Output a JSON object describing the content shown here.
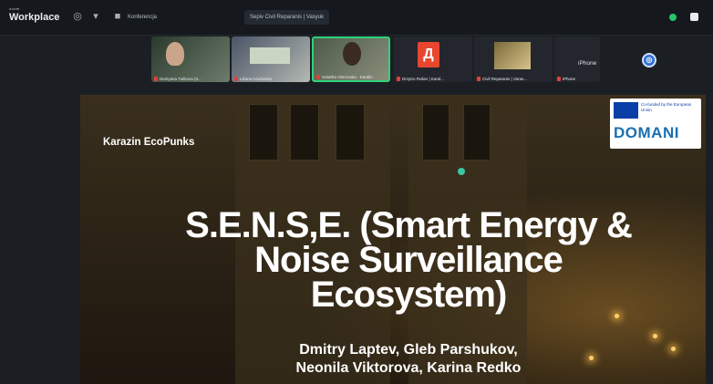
{
  "app": {
    "logo_small": "zoom",
    "logo_big": "Workplace"
  },
  "topbar": {
    "tab1": "Konferencja",
    "tab2": "Sepiv Civil Reparanis | Vasyuk"
  },
  "participants": [
    {
      "name": "Deniyana Tulikova (II..."
    },
    {
      "name": "Liliana Kaichenko"
    },
    {
      "name": "Sobelko Ostrovska - Karalin"
    },
    {
      "name": "Dmytro Ruliev | Karal..."
    },
    {
      "name": "Civil Reparanis | Varas..."
    },
    {
      "name": "iPhone"
    }
  ],
  "avatar_letter": "Д",
  "iphone_label": "iPhone",
  "slide": {
    "team": "Karazin EcoPunks",
    "headline": "S.E.N.S,E. (Smart Energy & Noise Surveillance Ecosystem)",
    "authors_line1": "Dmitry Laptev, Gleb Parshukov,",
    "authors_line2": "Neonila Viktorova, Karina Redko",
    "badge_text": "Co-funded by the European Union",
    "badge_brand": "DOMANI"
  }
}
